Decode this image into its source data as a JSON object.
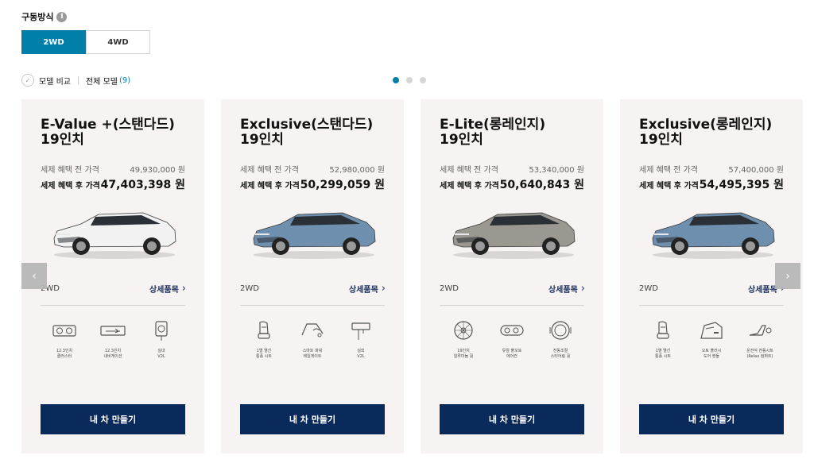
{
  "drive": {
    "title": "구동방식",
    "info_icon": "i",
    "options": [
      "2WD",
      "4WD"
    ],
    "selected": "2WD"
  },
  "compare": {
    "compare_label": "모델 비교",
    "all_models_label": "전체 모델",
    "count": "(9)"
  },
  "pagination": {
    "pages": 3,
    "current": 1
  },
  "labels": {
    "before_label": "세제 혜택 전 가격",
    "after_label": "세제 혜택 후 가격",
    "detail": "상세품목",
    "make": "내 차 만들기",
    "prev": "‹",
    "next": "›"
  },
  "cards": [
    {
      "name_line1": "E-Value +(스탠다드)",
      "name_line2": "19인치",
      "price_before": "49,930,000 원",
      "price_after": "47,403,398 원",
      "drive": "2WD",
      "car_color": "#f2f2f2",
      "features": [
        {
          "icon": "cluster-icon",
          "label": "12.3인치\n클러스터"
        },
        {
          "icon": "navigation-icon",
          "label": "12.3인치\n내비게이션"
        },
        {
          "icon": "v2l-icon",
          "label": "실내\nV2L"
        }
      ]
    },
    {
      "name_line1": "Exclusive(스탠다드)",
      "name_line2": "19인치",
      "price_before": "52,980,000 원",
      "price_after": "50,299,059 원",
      "drive": "2WD",
      "car_color": "#6f8fae",
      "features": [
        {
          "icon": "seat-icon",
          "label": "1열 열선\n통풍 시트"
        },
        {
          "icon": "tailgate-icon",
          "label": "스마트 파워\n테일게이트"
        },
        {
          "icon": "v2l-outdoor-icon",
          "label": "실외\nV2L"
        }
      ]
    },
    {
      "name_line1": "E-Lite(롱레인지)",
      "name_line2": "19인치",
      "price_before": "53,340,000 원",
      "price_after": "50,640,843 원",
      "drive": "2WD",
      "car_color": "#9a9891",
      "features": [
        {
          "icon": "wheel-icon",
          "label": "19인치\n알루미늄 휠"
        },
        {
          "icon": "headlamp-icon",
          "label": "듀얼 풀오토\n에어컨"
        },
        {
          "icon": "steering-icon",
          "label": "전동조절\n스티어링 휠"
        }
      ]
    },
    {
      "name_line1": "Exclusive(롱레인지)",
      "name_line2": "19인치",
      "price_before": "57,400,000 원",
      "price_after": "54,495,395 원",
      "drive": "2WD",
      "car_color": "#6f8fae",
      "features": [
        {
          "icon": "seat-icon",
          "label": "1열 열선\n통풍 시트"
        },
        {
          "icon": "door-handle-icon",
          "label": "오토 플러시\n도어 핸들"
        },
        {
          "icon": "relax-seat-icon",
          "label": "운전석 전동시트\n(Relax 컴퍼트)"
        }
      ]
    }
  ]
}
